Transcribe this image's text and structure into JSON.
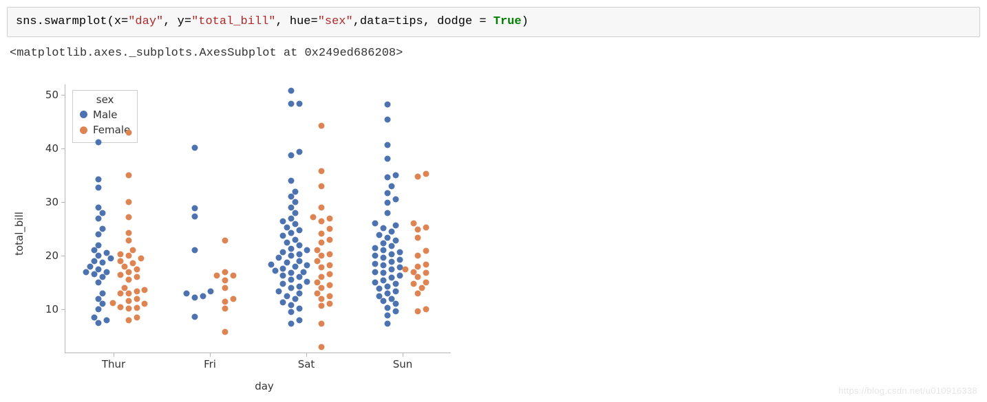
{
  "code": {
    "p1": "sns.swarmplot(x=",
    "s1": "\"day\"",
    "p2": ", y=",
    "s2": "\"total_bill\"",
    "p3": ", hue=",
    "s3": "\"sex\"",
    "p4": ",data=tips, dodge = ",
    "kw": "True",
    "p5": ")"
  },
  "output_repr": "<matplotlib.axes._subplots.AxesSubplot at 0x249ed686208>",
  "watermark": "https://blog.csdn.net/u010916338",
  "chart_data": {
    "type": "scatter",
    "swarm": true,
    "xlabel": "day",
    "ylabel": "total_bill",
    "categories": [
      "Thur",
      "Fri",
      "Sat",
      "Sun"
    ],
    "hue_title": "sex",
    "hue_levels": [
      "Male",
      "Female"
    ],
    "colors": {
      "Male": "#4c72b0",
      "Female": "#dd8452"
    },
    "yticks": [
      10,
      20,
      30,
      40,
      50
    ],
    "ylim": [
      2,
      52
    ],
    "legend_loc": "upper left",
    "series": [
      {
        "name": "Male",
        "points": {
          "Thur": [
            7.5,
            8,
            8.5,
            10,
            11,
            12,
            13,
            15,
            16,
            16.5,
            17,
            17,
            17.5,
            18,
            18.7,
            19,
            19.5,
            20,
            20.5,
            21,
            22,
            24,
            25,
            27,
            28,
            29,
            32.7,
            34.3,
            41.2
          ],
          "Fri": [
            8.6,
            12.2,
            12.5,
            13,
            13.4,
            21,
            27.3,
            28.9,
            40.2
          ],
          "Sat": [
            7.3,
            8,
            9.5,
            10.1,
            10.8,
            11.3,
            12,
            12.5,
            13,
            13.4,
            14,
            14.3,
            14.8,
            15.1,
            15.5,
            16,
            16.3,
            16.8,
            17,
            17.2,
            17.6,
            17.9,
            18.2,
            18.4,
            18.7,
            19,
            19.6,
            20,
            20.3,
            20.7,
            21,
            21.3,
            22,
            22.5,
            23,
            23.7,
            24.2,
            24.8,
            25.3,
            25.9,
            26.4,
            27,
            28,
            29,
            30,
            31,
            32,
            34,
            38.7,
            39.4,
            48.3,
            48.3,
            50.8
          ],
          "Sun": [
            7.3,
            8.8,
            9.6,
            10.3,
            11,
            11.5,
            12,
            12.5,
            13,
            13.4,
            13.8,
            14.3,
            14.8,
            15,
            15.4,
            15.9,
            16.3,
            16.8,
            17,
            17.4,
            17.8,
            18.2,
            18.5,
            18.8,
            19.2,
            19.6,
            20,
            20.3,
            20.7,
            21,
            21.4,
            21.8,
            22.3,
            22.8,
            23.3,
            23.8,
            24.5,
            25.2,
            25.6,
            26,
            28,
            29.9,
            30.5,
            31.7,
            32.9,
            34.6,
            35,
            38.1,
            40.6,
            45.4,
            48.2
          ]
        }
      },
      {
        "name": "Female",
        "points": {
          "Thur": [
            8,
            8.5,
            10.1,
            10.3,
            10.4,
            11,
            11.2,
            11.5,
            12,
            13,
            13,
            13.4,
            13.6,
            14,
            15.5,
            16,
            16.4,
            17,
            17.5,
            18,
            18.6,
            19,
            19.5,
            20,
            20.3,
            21,
            22.8,
            24.3,
            27.2,
            30,
            35,
            43
          ],
          "Fri": [
            5.8,
            10.1,
            11.4,
            12,
            14,
            15.4,
            16.3,
            16.3,
            17,
            22.8
          ],
          "Sat": [
            3,
            7.3,
            10.6,
            11,
            12,
            12.5,
            13,
            14,
            14.5,
            15,
            16,
            16.5,
            17.8,
            18.2,
            19,
            20.3,
            20,
            21,
            22.4,
            23,
            24.1,
            25,
            26.4,
            27,
            27.2,
            29,
            33,
            35.8,
            44.3
          ],
          "Sun": [
            9.6,
            10,
            13,
            14,
            14.8,
            15,
            16,
            16.8,
            17,
            17.5,
            18,
            18.4,
            20,
            20.9,
            23.3,
            24.9,
            25.3,
            26,
            34.8,
            35.3
          ]
        }
      }
    ]
  }
}
